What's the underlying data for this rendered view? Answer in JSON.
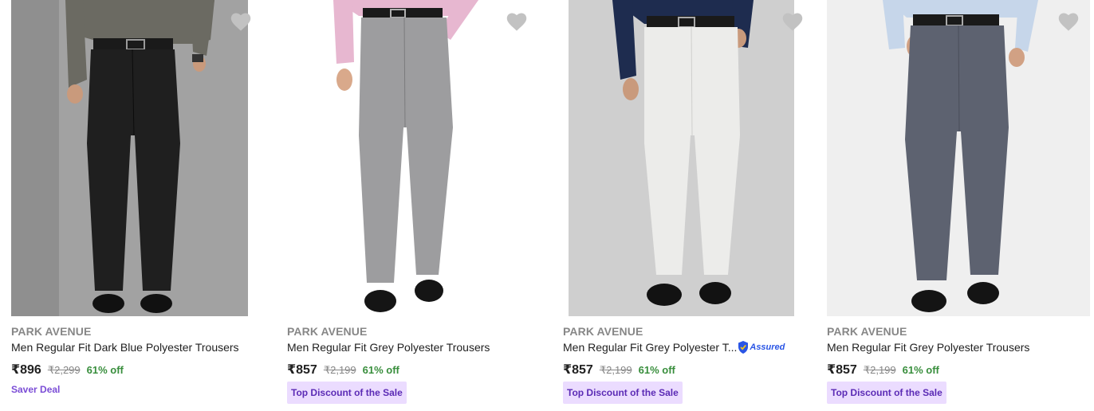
{
  "products": [
    {
      "brand": "PARK AVENUE",
      "title": "Men Regular Fit Dark Blue Polyester Trousers",
      "price": "₹896",
      "mrp": "₹2,299",
      "discount": "61% off",
      "badge": "Saver Deal",
      "badge_style": "text",
      "assured": false,
      "wishlist_icon": "heart-icon",
      "image_description": "model wearing dark trousers"
    },
    {
      "brand": "PARK AVENUE",
      "title": "Men Regular Fit Grey Polyester Trousers",
      "price": "₹857",
      "mrp": "₹2,199",
      "discount": "61% off",
      "badge": "Top Discount of the Sale",
      "badge_style": "pill",
      "assured": false,
      "wishlist_icon": "heart-icon"
    },
    {
      "brand": "PARK AVENUE",
      "title": "Men Regular Fit Grey Polyester T...",
      "price": "₹857",
      "mrp": "₹2,199",
      "discount": "61% off",
      "badge": "Top Discount of the Sale",
      "badge_style": "pill",
      "assured": true,
      "assured_label": "Assured",
      "wishlist_icon": "heart-icon"
    },
    {
      "brand": "PARK AVENUE",
      "title": "Men Regular Fit Grey Polyester Trousers",
      "price": "₹857",
      "mrp": "₹2,199",
      "discount": "61% off",
      "badge": "Top Discount of the Sale",
      "badge_style": "pill",
      "assured": false,
      "wishlist_icon": "heart-icon"
    }
  ],
  "colors": {
    "brand_text": "#878787",
    "discount": "#388e3c",
    "tag_bg": "#ebdcff",
    "tag_text": "#5b2bb5",
    "saver_text": "#7b4dd6",
    "heart": "#c2c2c2",
    "assured": "#2a55e5"
  }
}
